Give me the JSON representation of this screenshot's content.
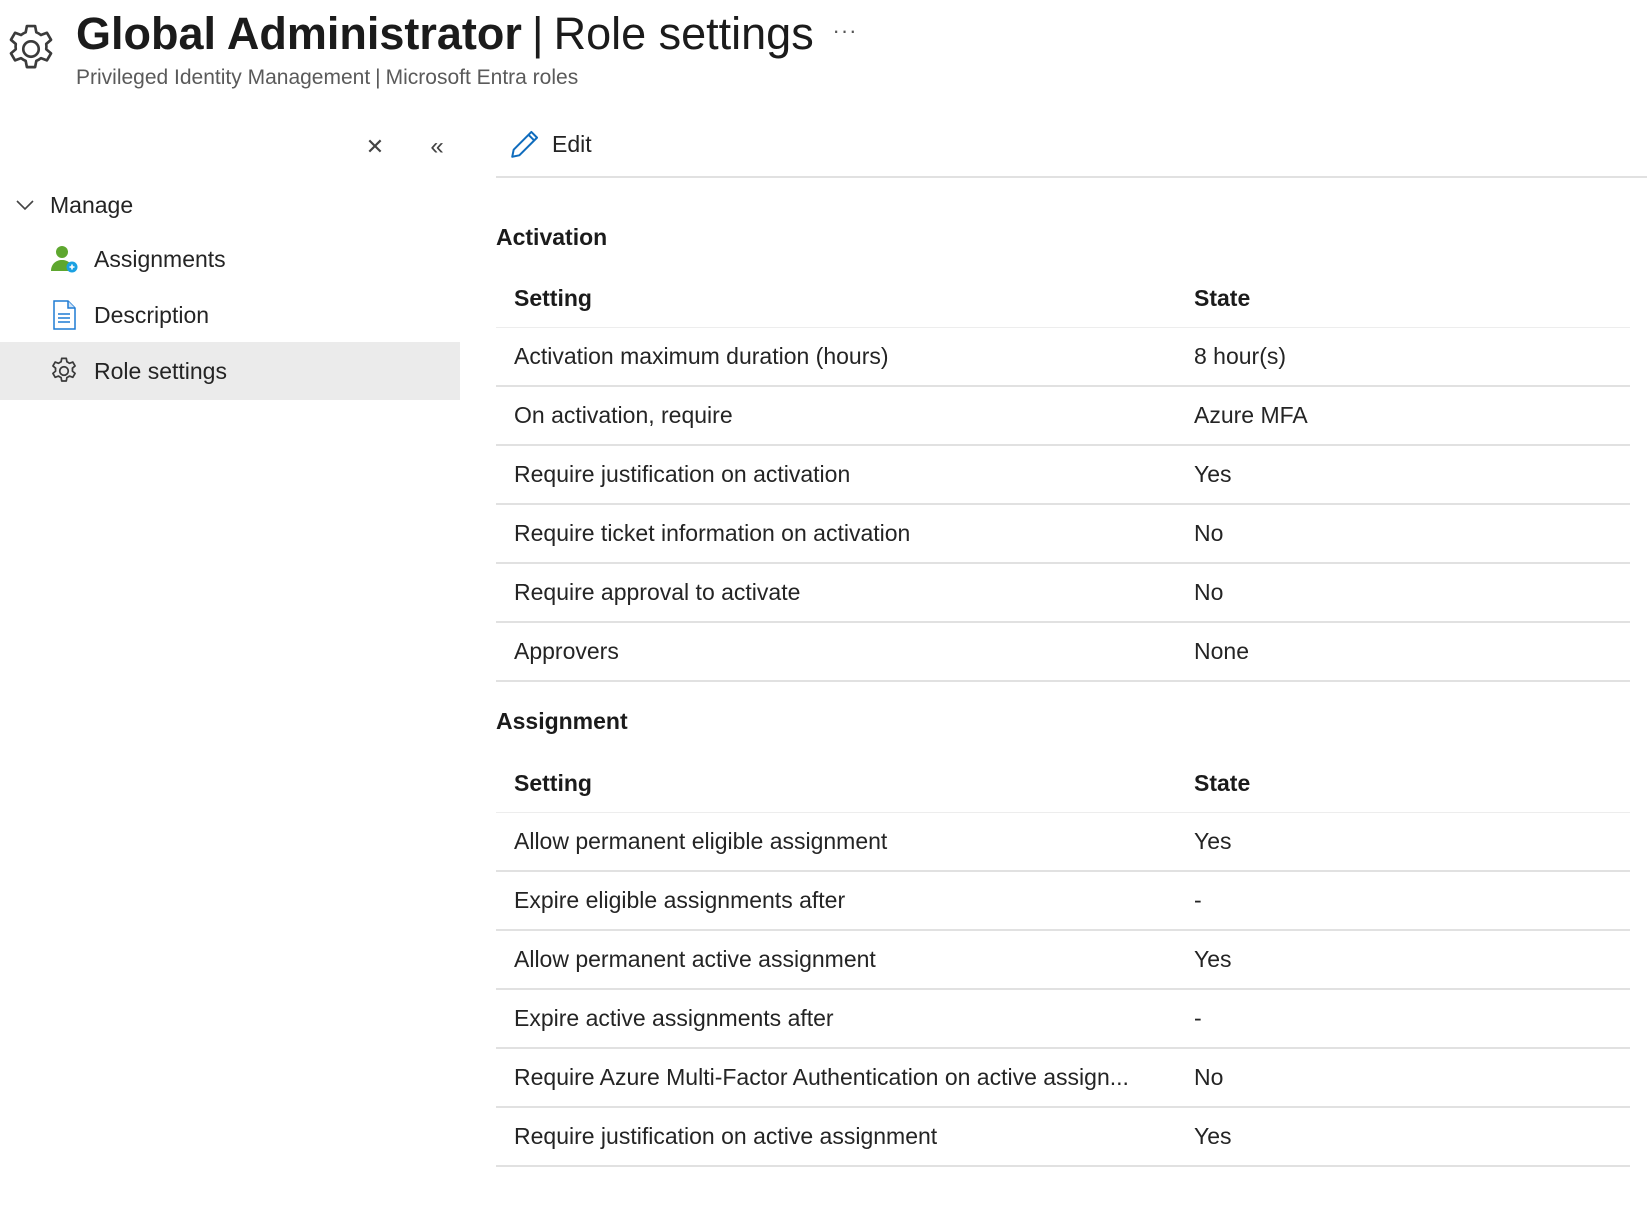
{
  "header": {
    "icon": "gear-icon",
    "title_main": "Global Administrator",
    "title_separator": "|",
    "title_sub": "Role settings",
    "more": "···",
    "breadcrumb": [
      "Privileged Identity Management",
      "Microsoft Entra roles"
    ],
    "breadcrumb_separator": "|"
  },
  "sidebar": {
    "close_icon": "close-icon",
    "close_glyph": "✕",
    "collapse_icon": "double-chevron-left-icon",
    "collapse_glyph": "«",
    "group_label": "Manage",
    "group_expanded": true,
    "items": [
      {
        "label": "Assignments",
        "icon": "assignments-user-icon",
        "selected": false
      },
      {
        "label": "Description",
        "icon": "document-icon",
        "selected": false
      },
      {
        "label": "Role settings",
        "icon": "gear-icon",
        "selected": true
      }
    ]
  },
  "toolbar": {
    "edit_label": "Edit",
    "edit_icon": "pencil-icon"
  },
  "activation": {
    "title": "Activation",
    "columns": [
      "Setting",
      "State"
    ],
    "rows": [
      {
        "setting": "Activation maximum duration (hours)",
        "state": "8 hour(s)"
      },
      {
        "setting": "On activation, require",
        "state": "Azure MFA"
      },
      {
        "setting": "Require justification on activation",
        "state": "Yes"
      },
      {
        "setting": "Require ticket information on activation",
        "state": "No"
      },
      {
        "setting": "Require approval to activate",
        "state": "No"
      },
      {
        "setting": "Approvers",
        "state": "None"
      }
    ]
  },
  "assignment": {
    "title": "Assignment",
    "columns": [
      "Setting",
      "State"
    ],
    "rows": [
      {
        "setting": "Allow permanent eligible assignment",
        "state": "Yes"
      },
      {
        "setting": "Expire eligible assignments after",
        "state": "-"
      },
      {
        "setting": "Allow permanent active assignment",
        "state": "Yes"
      },
      {
        "setting": "Expire active assignments after",
        "state": "-"
      },
      {
        "setting": "Require Azure Multi-Factor Authentication on active assign...",
        "state": "No"
      },
      {
        "setting": "Require justification on active assignment",
        "state": "Yes"
      }
    ]
  },
  "colors": {
    "accent": "#0f6cbd",
    "selected_bg": "#ebebeb",
    "divider": "#e1e1e1",
    "assignments_icon_green": "#5ea72f",
    "assignments_icon_blue": "#1ba1e2"
  }
}
